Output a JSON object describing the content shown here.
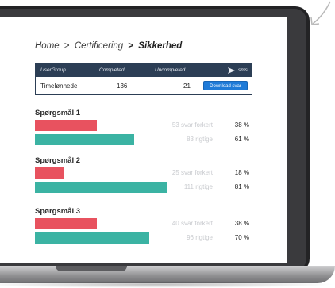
{
  "breadcrumb": {
    "home": "Home",
    "separator": ">",
    "section": "Certificering",
    "current": "Sikkerhed"
  },
  "table": {
    "columns": [
      "UserGroup",
      "Completed",
      "Uncompleted",
      "sms"
    ],
    "rows": [
      {
        "group": "Timelønnede",
        "completed": "136",
        "uncompleted": "21",
        "action": "Download svar"
      }
    ]
  },
  "questions": [
    {
      "title": "Spørgsmål 1",
      "wrong": {
        "caption": "53 svar forkert",
        "percent": "38 %",
        "fraction": 0.38
      },
      "right": {
        "caption": "83 rigtige",
        "percent": "61 %",
        "fraction": 0.61
      }
    },
    {
      "title": "Spørgsmål 2",
      "wrong": {
        "caption": "25 svar forkert",
        "percent": "18 %",
        "fraction": 0.18
      },
      "right": {
        "caption": "111 rigtige",
        "percent": "81 %",
        "fraction": 0.81
      }
    },
    {
      "title": "Spørgsmål 3",
      "wrong": {
        "caption": "40 svar forkert",
        "percent": "38 %",
        "fraction": 0.38
      },
      "right": {
        "caption": "96 rigtige",
        "percent": "70 %",
        "fraction": 0.7
      }
    }
  ],
  "colors": {
    "header": "#2c3e55",
    "wrong": "#e8525f",
    "right": "#3bb3a3",
    "button": "#1f7bd8"
  }
}
